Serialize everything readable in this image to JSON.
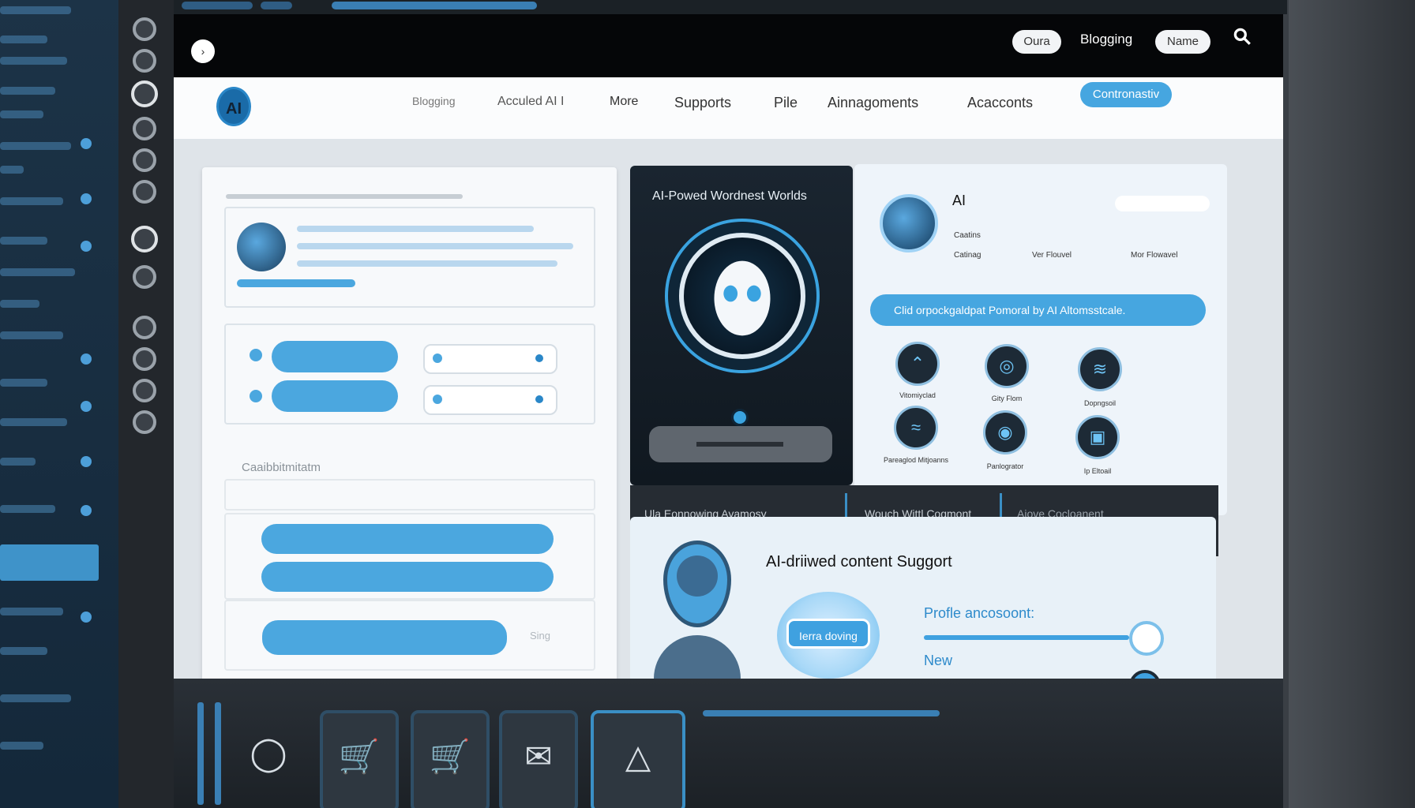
{
  "top_bar": {
    "home_icon": "chevron-right",
    "breadcrumb": "",
    "pill_one": "Oura",
    "link": "Blogging",
    "pill_two": "Name",
    "search_icon": "search-icon"
  },
  "nav": {
    "logo": "AI",
    "items": [
      "Blogging",
      "Acculed AI I",
      "More",
      "Supports",
      "Pile",
      "Ainnagoments",
      "Acacconts"
    ],
    "cta": "Contronastiv"
  },
  "ai_card": {
    "title": "AI-Powed Wordnest Worlds"
  },
  "profile_card": {
    "title": "AI",
    "field_label": "Caatins",
    "stats": [
      "Catinag",
      "Ver Flouvel",
      "Mor Flowavel"
    ],
    "banner": "Clid orpockgaldpat Pomoral by AI Altomsstcale.",
    "features": [
      {
        "label": "Vitomiyclad",
        "icon": "landscape"
      },
      {
        "label": "Gity Flom",
        "icon": "target"
      },
      {
        "label": "Dopngsoil",
        "icon": "wifi"
      },
      {
        "label": "Pareaglod Mitjoanns",
        "icon": "layers"
      },
      {
        "label": "Panlogrator",
        "icon": "compass"
      },
      {
        "label": "Ip Eltoail",
        "icon": "monitor"
      }
    ]
  },
  "tabs": [
    "Ula Eonnowing Ayamosy",
    "Wouch Wittl Cogmont",
    "Aiove Cocloanent"
  ],
  "support_card": {
    "title": "AI-driiwed content Suggort",
    "bubble_label": "Ierra doving",
    "slider_one_label": "Profle ancosoont:",
    "slider_one_value": 1.0,
    "slider_two_label": "New",
    "slider_two_value": 1.0
  },
  "left_panel": {
    "section_label": "Caaibbitmitatm",
    "button_label": "Sing"
  },
  "dock": {
    "icons": [
      "record-icon",
      "cart-icon",
      "cart-icon",
      "mail-icon",
      "triangle-icon"
    ]
  },
  "colors": {
    "accent": "#46a6e0",
    "dark": "#101820",
    "sidebar": "#1c3347"
  }
}
